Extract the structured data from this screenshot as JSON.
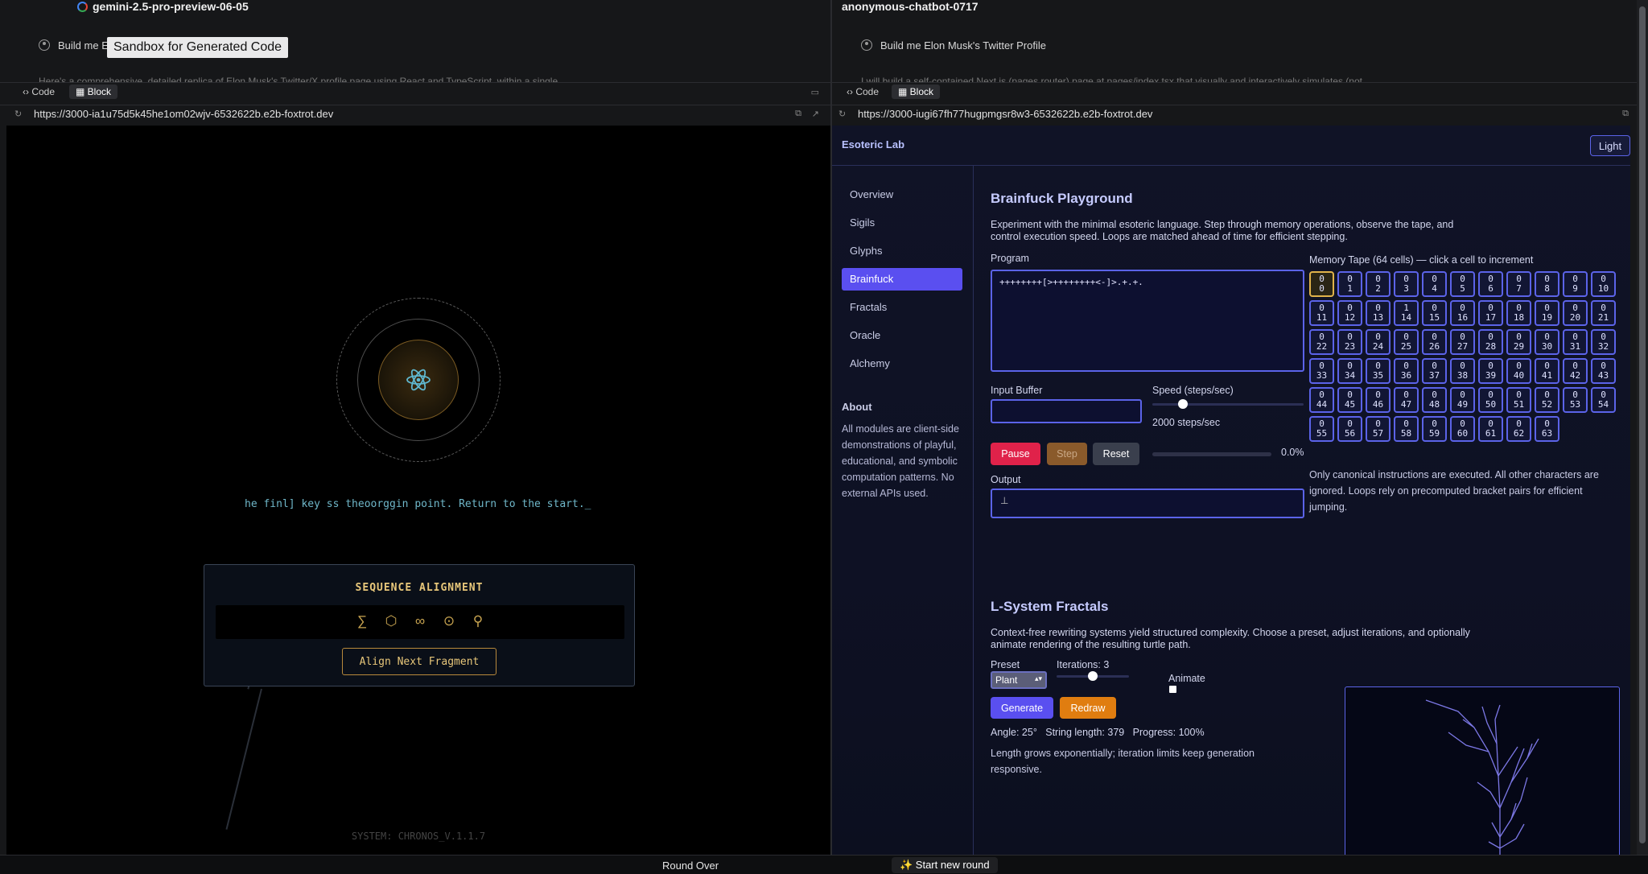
{
  "left": {
    "model": "gemini-2.5-pro-preview-06-05",
    "user_prompt": "Build me E",
    "assistant_preview": "Here's a comprehensive, detailed replica of Elon Musk's Twitter/X profile page using React and TypeScript, within a single",
    "tooltip": "Sandbox for Generated Code",
    "tabs": {
      "code": "Code",
      "block": "Block"
    },
    "url": "https://3000-ia1u75d5k45he1om02wjv-6532622b.e2b-foxtrot.dev",
    "game": {
      "terminal_text": "he finl] key ss theoorggin point. Return to the start._",
      "panel_title": "SEQUENCE ALIGNMENT",
      "glyphs": [
        "∑",
        "⬡",
        "∞",
        "⊙",
        "⚲"
      ],
      "button": "Align Next Fragment",
      "footer": "SYSTEM: CHRONOS_V.1.1.7"
    }
  },
  "right": {
    "model": "anonymous-chatbot-0717",
    "user_prompt": "Build me Elon Musk's Twitter Profile",
    "assistant_preview": "I will build a self-contained Next.js (pages router) page at pages/index.tsx that visually and interactively simulates (not",
    "tabs": {
      "code": "Code",
      "block": "Block"
    },
    "url": "https://3000-iugi67fh77hugpmgsr8w3-6532622b.e2b-foxtrot.dev",
    "app": {
      "brand": "Esoteric Lab",
      "theme_button": "Light",
      "nav": [
        "Overview",
        "Sigils",
        "Glyphs",
        "Brainfuck",
        "Fractals",
        "Oracle",
        "Alchemy"
      ],
      "nav_active": "Brainfuck",
      "about_title": "About",
      "about_text": "All modules are client-side demonstrations of playful, educational, and symbolic computation patterns. No external APIs used.",
      "bf": {
        "title": "Brainfuck Playground",
        "desc": "Experiment with the minimal esoteric language. Step through memory operations, observe the tape, and control execution speed. Loops are matched ahead of time for efficient stepping.",
        "program_label": "Program",
        "program": "++++++++[>++++++++<-]>.+.+.",
        "input_label": "Input Buffer",
        "input_value": "",
        "speed_label": "Speed (steps/sec)",
        "speed_value": "2000 steps/sec",
        "speed_fraction": 0.2,
        "pause": "Pause",
        "step": "Step",
        "reset": "Reset",
        "progress": "0.0%",
        "output_label": "Output",
        "output_value": "⊥",
        "tape_label": "Memory Tape (64 cells) — click a cell to increment",
        "tape_values": [
          0,
          0,
          0,
          0,
          0,
          0,
          0,
          0,
          0,
          0,
          0,
          0,
          0,
          0,
          1,
          0,
          0,
          0,
          0,
          0,
          0,
          0,
          0,
          0,
          0,
          0,
          0,
          0,
          0,
          0,
          0,
          0,
          0,
          0,
          0,
          0,
          0,
          0,
          0,
          0,
          0,
          0,
          0,
          0,
          0,
          0,
          0,
          0,
          0,
          0,
          0,
          0,
          0,
          0,
          0,
          0,
          0,
          0,
          0,
          0,
          0,
          0,
          0,
          0
        ],
        "tape_highlight": 0,
        "note": "Only canonical instructions are executed. All other characters are ignored. Loops rely on precomputed bracket pairs for efficient jumping."
      },
      "ls": {
        "title": "L-System Fractals",
        "desc": "Context-free rewriting systems yield structured complexity. Choose a preset, adjust iterations, and optionally animate rendering of the resulting turtle path.",
        "preset_label": "Preset",
        "preset": "Plant",
        "iterations_label": "Iterations: 3",
        "iterations_fraction": 0.5,
        "animate_label": "Animate",
        "generate": "Generate",
        "redraw": "Redraw",
        "stats": "Angle: 25°   String length: 379   Progress: 100%",
        "note": "Length grows exponentially; iteration limits keep generation responsive."
      }
    }
  },
  "bottom": {
    "round_over": "Round Over",
    "new_round": "✨ Start new round"
  },
  "colors": {
    "accent": "#5a4ff0",
    "pause": "#e0224a",
    "step": "#8a5a2b",
    "reset": "#3a3f4d",
    "redraw": "#e07d10",
    "gold": "#e8c77a"
  }
}
